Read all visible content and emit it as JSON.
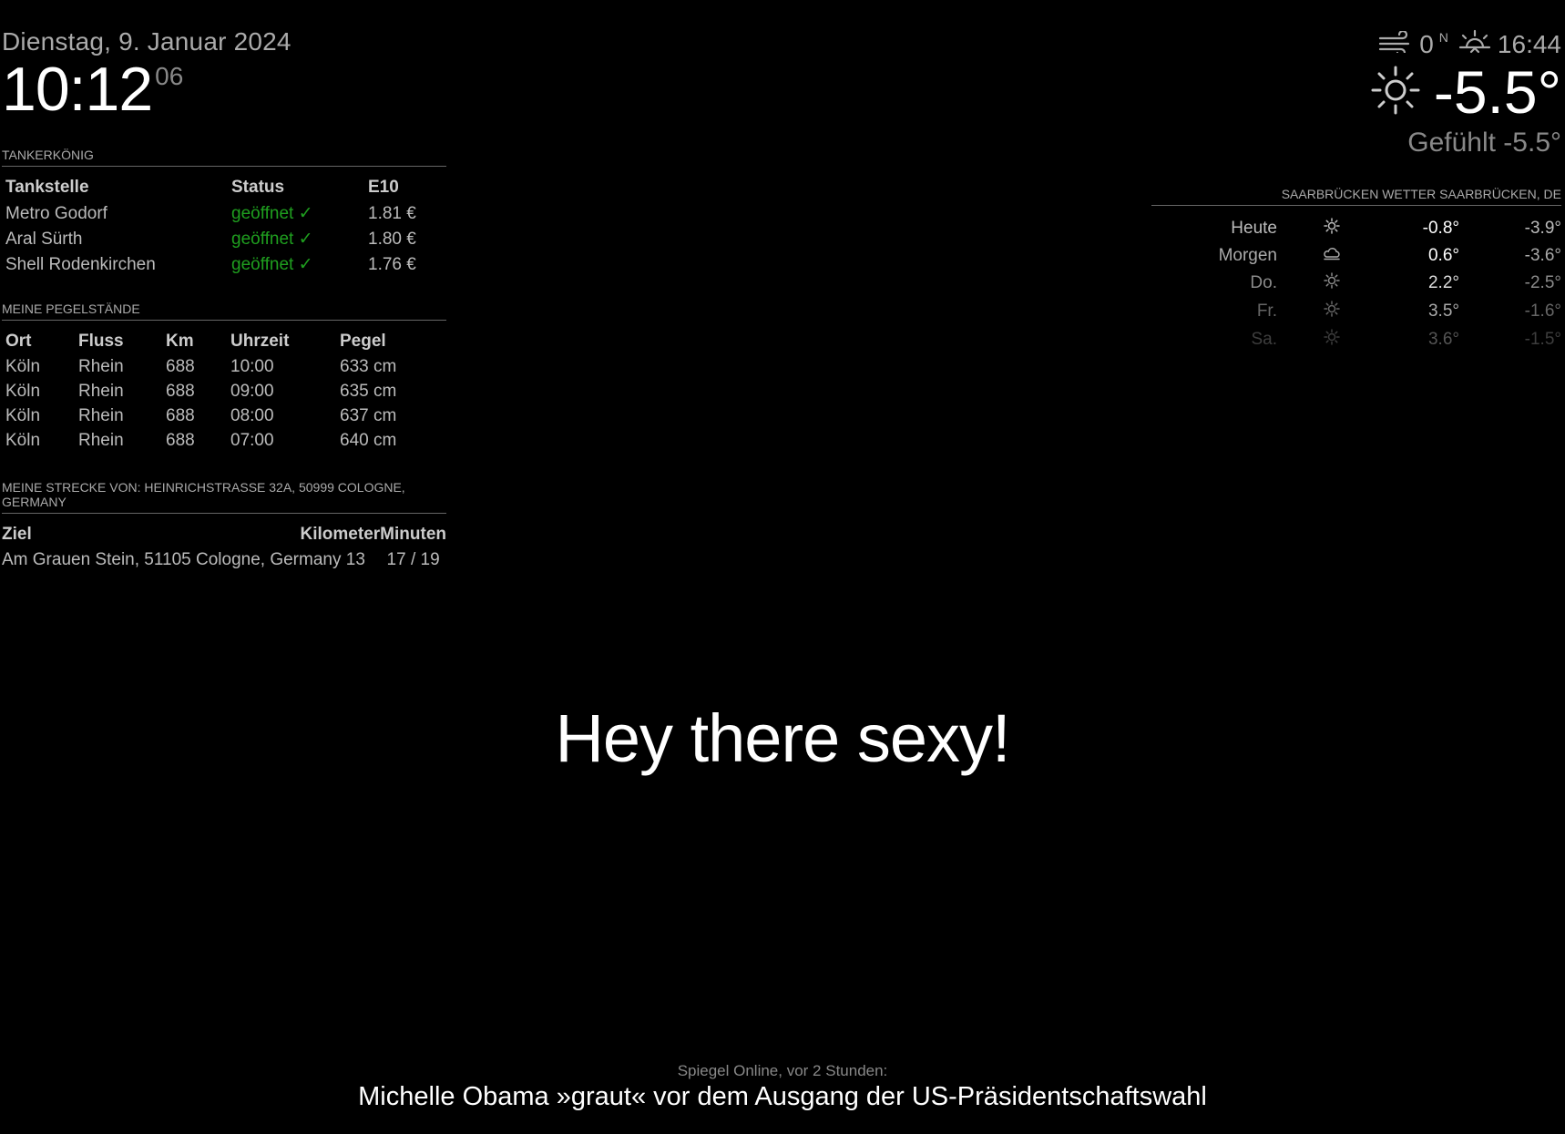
{
  "clock": {
    "date": "Dienstag, 9. Januar 2024",
    "time": "10:12",
    "seconds": "06"
  },
  "tankerkoenig": {
    "header": "Tankerkönig",
    "columns": [
      "Tankstelle",
      "Status",
      "E10"
    ],
    "rows": [
      {
        "name": "Metro Godorf",
        "status": "geöffnet ✓",
        "price": "1.81 €"
      },
      {
        "name": "Aral Sürth",
        "status": "geöffnet ✓",
        "price": "1.80 €"
      },
      {
        "name": "Shell Rodenkirchen",
        "status": "geöffnet ✓",
        "price": "1.76 €"
      }
    ],
    "status_color": "#1f9f1f"
  },
  "pegel": {
    "header": "Meine Pegelstände",
    "columns": [
      "Ort",
      "Fluss",
      "Km",
      "Uhrzeit",
      "Pegel"
    ],
    "rows": [
      {
        "ort": "Köln",
        "fluss": "Rhein",
        "km": "688",
        "zeit": "10:00",
        "pegel": "633 cm"
      },
      {
        "ort": "Köln",
        "fluss": "Rhein",
        "km": "688",
        "zeit": "09:00",
        "pegel": "635 cm"
      },
      {
        "ort": "Köln",
        "fluss": "Rhein",
        "km": "688",
        "zeit": "08:00",
        "pegel": "637 cm"
      },
      {
        "ort": "Köln",
        "fluss": "Rhein",
        "km": "688",
        "zeit": "07:00",
        "pegel": "640 cm"
      }
    ]
  },
  "route": {
    "header": "Meine Strecke von: Heinrichstrasse 32a, 50999 Cologne, Germany",
    "columns": [
      "Ziel",
      "Kilometer",
      "Minuten"
    ],
    "row": {
      "ziel": "Am Grauen Stein, 51105 Cologne, Germany",
      "km": "13",
      "minuten": "17 / 19"
    }
  },
  "weather": {
    "wind_speed": "0",
    "wind_dir": "N",
    "sunset_time": "16:44",
    "temperature": "-5.5°",
    "feels_like": "Gefühlt -5.5°",
    "icons": {
      "wind": "wind-icon",
      "sunset": "sunset-icon",
      "current": "sun-icon"
    }
  },
  "forecast": {
    "header": "Saarbrücken Wetter Saarbrücken, DE",
    "days": [
      {
        "day": "Heute",
        "icon": "sun-icon",
        "max": "-0.8°",
        "min": "-3.9°"
      },
      {
        "day": "Morgen",
        "icon": "cloud-icon",
        "max": "0.6°",
        "min": "-3.6°"
      },
      {
        "day": "Do.",
        "icon": "sun-icon",
        "max": "2.2°",
        "min": "-2.5°"
      },
      {
        "day": "Fr.",
        "icon": "sun-icon",
        "max": "3.5°",
        "min": "-1.6°"
      },
      {
        "day": "Sa.",
        "icon": "sun-icon",
        "max": "3.6°",
        "min": "-1.5°"
      }
    ]
  },
  "compliment": "Hey there sexy!",
  "news": {
    "source": "Spiegel Online, vor 2 Stunden:",
    "title": "Michelle Obama »graut« vor dem Ausgang der US-Präsidentschaftswahl"
  }
}
